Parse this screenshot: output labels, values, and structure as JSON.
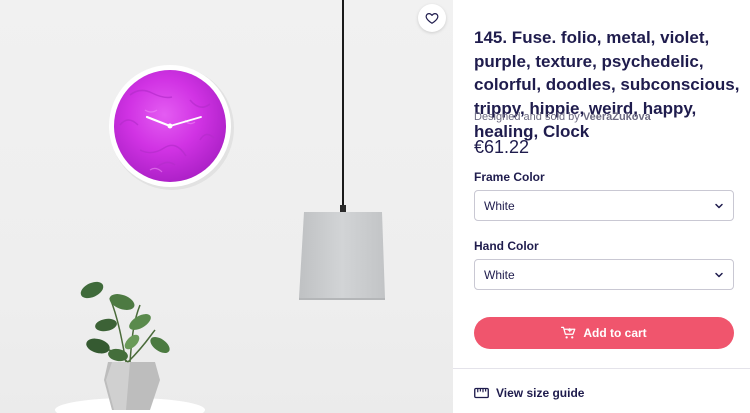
{
  "product": {
    "title": "145. Fuse. folio, metal, violet, purple, texture, psychedelic, colorful, doodles, subconscious, trippy, hippie, weird, happy, healing, Clock",
    "designed_prefix": "Designed and sold by",
    "artist": "VeeraZukova",
    "price": "€61.22"
  },
  "options": {
    "frame_label": "Frame Color",
    "frame_value": "White",
    "hand_label": "Hand Color",
    "hand_value": "White"
  },
  "actions": {
    "add_to_cart": "Add to cart",
    "size_guide": "View size guide"
  },
  "colors": {
    "accent": "#f0556d",
    "text": "#1f1c4d",
    "clock_face": "#d438e6"
  },
  "icons": [
    "heart-icon",
    "cart-icon",
    "chevron-down-icon",
    "ruler-icon"
  ]
}
